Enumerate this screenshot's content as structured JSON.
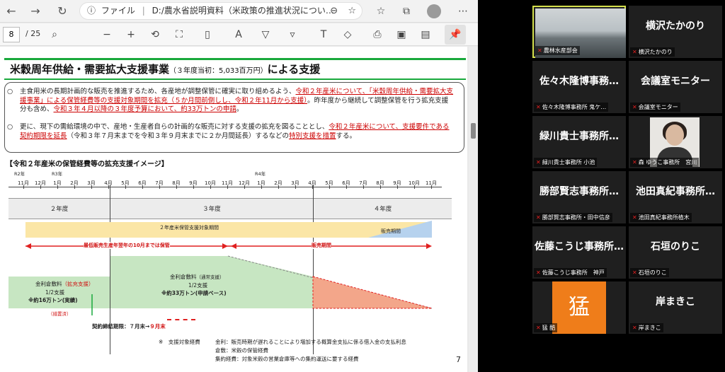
{
  "browser": {
    "address_prefix": "ファイル",
    "address_path": "D:/農水省説明資料（米政策の推進状況につい…"
  },
  "pdf_toolbar": {
    "page_current": "8",
    "page_total": "/ 25"
  },
  "slide": {
    "title_main": "米穀周年供給・需要拡大支援事業",
    "title_budget": "（３年度当初：5,033百万円）",
    "title_suffix": "による支援",
    "para1_bullet": "○",
    "para1_a": "主食用米の長期計画的な販売を推進するため、各産地が調整保管に確実に取り組めるよう、",
    "para1_red1": "令和２年産米について、「米穀周年供給・需要拡大支援事業」による保管経費等の支援対象期間を拡充（５か月間前倒しし、令和２年11月から支援）",
    "para1_b": "。昨年度から継続して調整保管を行う拡充支援分も含め、",
    "para1_red2": "令和３年４月以降の３年度予算において、約33万トンの申請",
    "para1_c": "。",
    "para2_bullet": "○",
    "para2_a": "更に、現下の需給環境の中で、産地・生産者自らの計画的な販売に対する支援の拡充を図ることとし、",
    "para2_red1": "令和２年産米について、支援要件である契約期限を延長",
    "para2_b": "（令和３年７月末までを令和３年９月末までに２か月間延長）するなどの",
    "para2_red2": "特別支援を措置",
    "para2_c": "する。",
    "image_title": "【令和２年産米の保管経費等の拡充支援イメージ】",
    "r2": "R2年",
    "r3": "R3年",
    "r4": "R4年",
    "months": [
      "11月",
      "12月",
      "1月",
      "2月",
      "3月",
      "4月",
      "5月",
      "6月",
      "7月",
      "8月",
      "9月",
      "10月",
      "11月",
      "12月",
      "1月",
      "2月",
      "3月",
      "4月",
      "5月",
      "6月",
      "7月",
      "8月",
      "9月",
      "10月",
      "11月"
    ],
    "years": [
      "２年度",
      "３年度",
      "４年度"
    ],
    "bar_period": "２年産米保管支援対象期間",
    "bar_sales": "販売期間",
    "arrow_storage": "最低販売生産年翌年の10月までは保管",
    "arrow_sales": "販売期間",
    "kinri_left_title": "金利倉敷料",
    "kinri_left_note": "（拡充支援）",
    "kinri_left_rate": "1/2支援",
    "kinri_left_amount": "※約16万トン(実績)",
    "kinri_left_measure": "（措置済）",
    "kinri_mid_title": "金利倉敷料",
    "kinri_mid_note": "（通常支援）",
    "kinri_mid_rate": "1/2支援",
    "kinri_mid_amount": "※約33万トン(申請ベース)",
    "contract_deadline": "契約締結期限：７月末→",
    "contract_new": "９月末",
    "footnote_mark": "※　支援対象経費",
    "footnote_1": "金利：販売時期が遅れることにより増加する概算金支払に係る借入金の支払利息",
    "footnote_2": "倉敷：米穀の保管経費",
    "footnote_3": "集約経費：対象米穀の営業倉庫等への集約運送に要する経費",
    "page_number": "7"
  },
  "participants": [
    {
      "big": "",
      "label": "農林水産部会"
    },
    {
      "big": "横沢たかのり",
      "label": "横沢たかのり"
    },
    {
      "big": "佐々木隆博事務…",
      "label": "佐々木隆博事務所 鬼ケ…"
    },
    {
      "big": "会議室モニター",
      "label": "会議室モニター"
    },
    {
      "big": "緑川貴士事務所…",
      "label": "緑川貴士事務所 小池"
    },
    {
      "big": "",
      "label": "森 ゆうこ事務所　宮川"
    },
    {
      "big": "勝部賢志事務所…",
      "label": "勝部賢志事務所・田中信彦"
    },
    {
      "big": "池田真紀事務所…",
      "label": "池田真紀事務所植木"
    },
    {
      "big": "佐藤こうじ事務所…",
      "label": "佐藤こうじ事務所　神戸"
    },
    {
      "big": "石垣のりこ",
      "label": "石垣のりこ"
    },
    {
      "big": "猛",
      "label": "猛 酷"
    },
    {
      "big": "岸まきこ",
      "label": "岸まきこ"
    }
  ],
  "colors": {
    "accent_green": "#19a93c",
    "highlight_red": "#cc0000",
    "tile_bg": "#1f1f1f",
    "active_border": "#d4e04c"
  }
}
